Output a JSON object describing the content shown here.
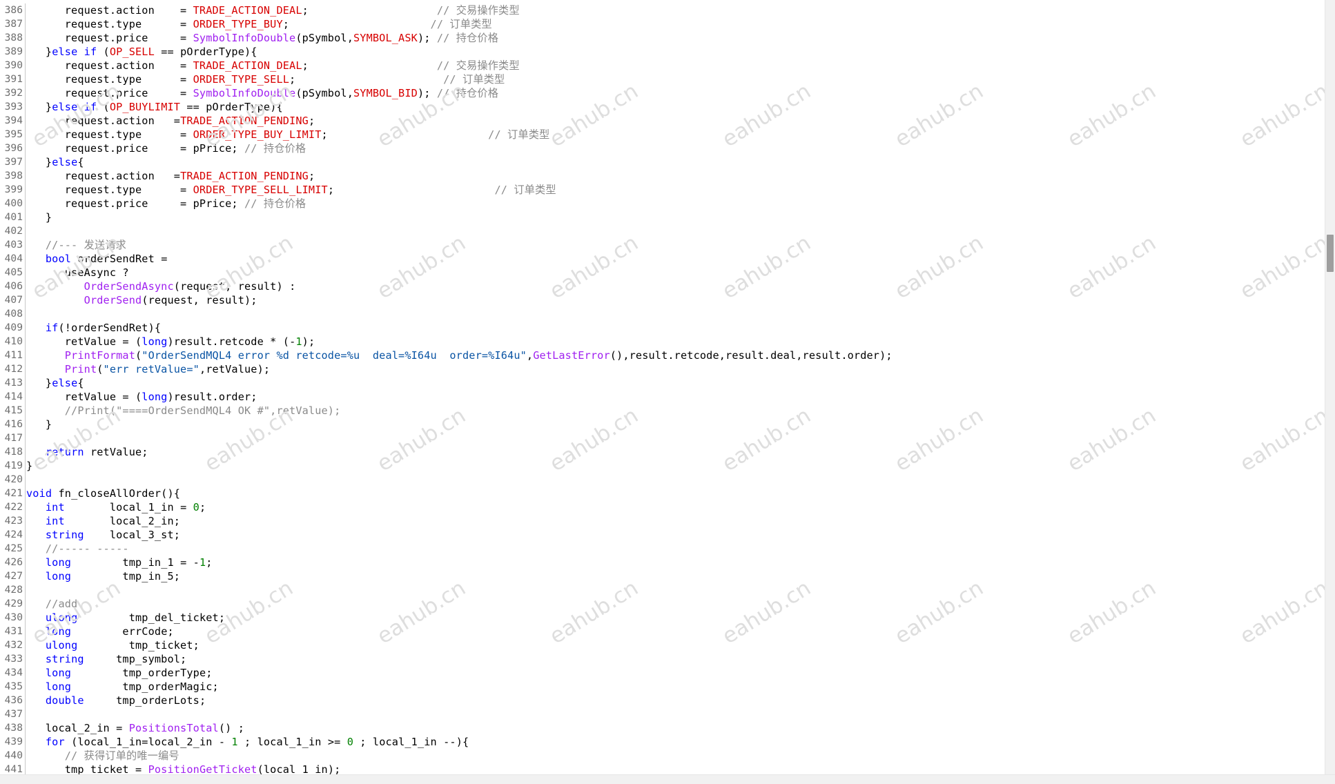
{
  "watermark": "eahub.cn",
  "lines": [
    {
      "n": "386",
      "tokens": [
        [
          "",
          "      request.action    = "
        ],
        [
          "cst",
          "TRADE_ACTION_DEAL"
        ],
        [
          "",
          ";                    "
        ],
        [
          "cm",
          "// 交易操作类型"
        ]
      ]
    },
    {
      "n": "387",
      "tokens": [
        [
          "",
          "      request.type      = "
        ],
        [
          "cst",
          "ORDER_TYPE_BUY"
        ],
        [
          "",
          ";                      "
        ],
        [
          "cm",
          "// 订单类型"
        ]
      ]
    },
    {
      "n": "388",
      "tokens": [
        [
          "",
          "      request.price     = "
        ],
        [
          "fn",
          "SymbolInfoDouble"
        ],
        [
          "",
          "(pSymbol,"
        ],
        [
          "cst",
          "SYMBOL_ASK"
        ],
        [
          "",
          "); "
        ],
        [
          "cm",
          "// 持仓价格"
        ]
      ]
    },
    {
      "n": "389",
      "tokens": [
        [
          "",
          "   }"
        ],
        [
          "kw",
          "else if"
        ],
        [
          "",
          " ("
        ],
        [
          "cst",
          "OP_SELL"
        ],
        [
          "",
          " == pOrderType){"
        ]
      ]
    },
    {
      "n": "390",
      "tokens": [
        [
          "",
          "      request.action    = "
        ],
        [
          "cst",
          "TRADE_ACTION_DEAL"
        ],
        [
          "",
          ";                    "
        ],
        [
          "cm",
          "// 交易操作类型"
        ]
      ]
    },
    {
      "n": "391",
      "tokens": [
        [
          "",
          "      request.type      = "
        ],
        [
          "cst",
          "ORDER_TYPE_SELL"
        ],
        [
          "",
          ";                       "
        ],
        [
          "cm",
          "// 订单类型"
        ]
      ]
    },
    {
      "n": "392",
      "tokens": [
        [
          "",
          "      request.price     = "
        ],
        [
          "fn",
          "SymbolInfoDouble"
        ],
        [
          "",
          "(pSymbol,"
        ],
        [
          "cst",
          "SYMBOL_BID"
        ],
        [
          "",
          "); "
        ],
        [
          "cm",
          "// 持仓价格"
        ]
      ]
    },
    {
      "n": "393",
      "tokens": [
        [
          "",
          "   }"
        ],
        [
          "kw",
          "else if"
        ],
        [
          "",
          " ("
        ],
        [
          "cst",
          "OP_BUYLIMIT"
        ],
        [
          "",
          " == pOrderType){"
        ]
      ]
    },
    {
      "n": "394",
      "tokens": [
        [
          "",
          "      request.action   ="
        ],
        [
          "cst",
          "TRADE_ACTION_PENDING"
        ],
        [
          ";",
          ";"
        ]
      ]
    },
    {
      "n": "395",
      "tokens": [
        [
          "",
          "      request.type      = "
        ],
        [
          "cst",
          "ORDER_TYPE_BUY_LIMIT"
        ],
        [
          "",
          ";                         "
        ],
        [
          "cm",
          "// 订单类型"
        ]
      ]
    },
    {
      "n": "396",
      "tokens": [
        [
          "",
          "      request.price     = pPrice; "
        ],
        [
          "cm",
          "// 持仓价格"
        ]
      ]
    },
    {
      "n": "397",
      "tokens": [
        [
          "",
          "   }"
        ],
        [
          "kw",
          "else"
        ],
        [
          "",
          "{"
        ]
      ]
    },
    {
      "n": "398",
      "tokens": [
        [
          "",
          "      request.action   ="
        ],
        [
          "cst",
          "TRADE_ACTION_PENDING"
        ],
        [
          "",
          ";"
        ]
      ]
    },
    {
      "n": "399",
      "tokens": [
        [
          "",
          "      request.type      = "
        ],
        [
          "cst",
          "ORDER_TYPE_SELL_LIMIT"
        ],
        [
          "",
          ";                         "
        ],
        [
          "cm",
          "// 订单类型"
        ]
      ]
    },
    {
      "n": "400",
      "tokens": [
        [
          "",
          "      request.price     = pPrice; "
        ],
        [
          "cm",
          "// 持仓价格"
        ]
      ]
    },
    {
      "n": "401",
      "tokens": [
        [
          "",
          "   }"
        ]
      ]
    },
    {
      "n": "402",
      "tokens": []
    },
    {
      "n": "403",
      "tokens": [
        [
          "cm",
          "   //--- 发送请求"
        ]
      ]
    },
    {
      "n": "404",
      "tokens": [
        [
          "",
          "   "
        ],
        [
          "ty",
          "bool"
        ],
        [
          "",
          " orderSendRet ="
        ]
      ]
    },
    {
      "n": "405",
      "tokens": [
        [
          "",
          "      useAsync ?"
        ]
      ]
    },
    {
      "n": "406",
      "tokens": [
        [
          "",
          "         "
        ],
        [
          "fn",
          "OrderSendAsync"
        ],
        [
          "",
          "(request, result) :"
        ]
      ]
    },
    {
      "n": "407",
      "tokens": [
        [
          "",
          "         "
        ],
        [
          "fn",
          "OrderSend"
        ],
        [
          "",
          "(request, result);"
        ]
      ]
    },
    {
      "n": "408",
      "tokens": []
    },
    {
      "n": "409",
      "tokens": [
        [
          "",
          "   "
        ],
        [
          "kw",
          "if"
        ],
        [
          "",
          "(!orderSendRet){"
        ]
      ]
    },
    {
      "n": "410",
      "tokens": [
        [
          "",
          "      retValue = ("
        ],
        [
          "ty",
          "long"
        ],
        [
          "",
          ")result.retcode * (-"
        ],
        [
          "num",
          "1"
        ],
        [
          "",
          ");"
        ]
      ]
    },
    {
      "n": "411",
      "tokens": [
        [
          "",
          "      "
        ],
        [
          "fn",
          "PrintFormat"
        ],
        [
          "",
          "("
        ],
        [
          "str",
          "\"OrderSendMQL4 error %d retcode=%u  deal=%I64u  order=%I64u\""
        ],
        [
          "",
          ","
        ],
        [
          "fn",
          "GetLastError"
        ],
        [
          "",
          "(),result.retcode,result.deal,result.order);"
        ]
      ]
    },
    {
      "n": "412",
      "tokens": [
        [
          "",
          "      "
        ],
        [
          "fn",
          "Print"
        ],
        [
          "",
          "("
        ],
        [
          "str",
          "\"err retValue=\""
        ],
        [
          "",
          ",retValue);"
        ]
      ]
    },
    {
      "n": "413",
      "tokens": [
        [
          "",
          "   }"
        ],
        [
          "kw",
          "else"
        ],
        [
          "",
          "{"
        ]
      ]
    },
    {
      "n": "414",
      "tokens": [
        [
          "",
          "      retValue = ("
        ],
        [
          "ty",
          "long"
        ],
        [
          "",
          ")result.order;"
        ]
      ]
    },
    {
      "n": "415",
      "tokens": [
        [
          "cm",
          "      //Print(\"====OrderSendMQL4 OK #\",retValue);"
        ]
      ]
    },
    {
      "n": "416",
      "tokens": [
        [
          "",
          "   }"
        ]
      ]
    },
    {
      "n": "417",
      "tokens": []
    },
    {
      "n": "418",
      "tokens": [
        [
          "",
          "   "
        ],
        [
          "kw",
          "return"
        ],
        [
          "",
          " retValue;"
        ]
      ]
    },
    {
      "n": "419",
      "tokens": [
        [
          "",
          "}"
        ]
      ]
    },
    {
      "n": "420",
      "tokens": []
    },
    {
      "n": "421",
      "tokens": [
        [
          "ty",
          "void"
        ],
        [
          "",
          " fn_closeAllOrder(){"
        ]
      ]
    },
    {
      "n": "422",
      "tokens": [
        [
          "",
          "   "
        ],
        [
          "ty",
          "int"
        ],
        [
          "",
          "       local_1_in = "
        ],
        [
          "num",
          "0"
        ],
        [
          "",
          ";"
        ]
      ]
    },
    {
      "n": "423",
      "tokens": [
        [
          "",
          "   "
        ],
        [
          "ty",
          "int"
        ],
        [
          "",
          "       local_2_in;"
        ]
      ]
    },
    {
      "n": "424",
      "tokens": [
        [
          "",
          "   "
        ],
        [
          "ty",
          "string"
        ],
        [
          "",
          "    local_3_st;"
        ]
      ]
    },
    {
      "n": "425",
      "tokens": [
        [
          "cm",
          "   //----- -----"
        ]
      ]
    },
    {
      "n": "426",
      "tokens": [
        [
          "",
          "   "
        ],
        [
          "ty",
          "long"
        ],
        [
          "",
          "        tmp_in_1 = -"
        ],
        [
          "num",
          "1"
        ],
        [
          "",
          ";"
        ]
      ]
    },
    {
      "n": "427",
      "tokens": [
        [
          "",
          "   "
        ],
        [
          "ty",
          "long"
        ],
        [
          "",
          "        tmp_in_5;"
        ]
      ]
    },
    {
      "n": "428",
      "tokens": []
    },
    {
      "n": "429",
      "tokens": [
        [
          "cm",
          "   //add"
        ]
      ]
    },
    {
      "n": "430",
      "tokens": [
        [
          "",
          "   "
        ],
        [
          "ty",
          "ulong"
        ],
        [
          "",
          "        tmp_del_ticket;"
        ]
      ]
    },
    {
      "n": "431",
      "tokens": [
        [
          "",
          "   "
        ],
        [
          "ty",
          "long"
        ],
        [
          "",
          "        errCode;"
        ]
      ]
    },
    {
      "n": "432",
      "tokens": [
        [
          "",
          "   "
        ],
        [
          "ty",
          "ulong"
        ],
        [
          "",
          "        tmp_ticket;"
        ]
      ]
    },
    {
      "n": "433",
      "tokens": [
        [
          "",
          "   "
        ],
        [
          "ty",
          "string"
        ],
        [
          "",
          "     tmp_symbol;"
        ]
      ]
    },
    {
      "n": "434",
      "tokens": [
        [
          "",
          "   "
        ],
        [
          "ty",
          "long"
        ],
        [
          "",
          "        tmp_orderType;"
        ]
      ]
    },
    {
      "n": "435",
      "tokens": [
        [
          "",
          "   "
        ],
        [
          "ty",
          "long"
        ],
        [
          "",
          "        tmp_orderMagic;"
        ]
      ]
    },
    {
      "n": "436",
      "tokens": [
        [
          "",
          "   "
        ],
        [
          "ty",
          "double"
        ],
        [
          "",
          "     tmp_orderLots;"
        ]
      ]
    },
    {
      "n": "437",
      "tokens": []
    },
    {
      "n": "438",
      "tokens": [
        [
          "",
          "   local_2_in = "
        ],
        [
          "fn",
          "PositionsTotal"
        ],
        [
          "",
          "() ;"
        ]
      ]
    },
    {
      "n": "439",
      "tokens": [
        [
          "",
          "   "
        ],
        [
          "kw",
          "for"
        ],
        [
          "",
          " (local_1_in=local_2_in - "
        ],
        [
          "num",
          "1"
        ],
        [
          "",
          " ; local_1_in >= "
        ],
        [
          "num",
          "0"
        ],
        [
          "",
          " ; local_1_in --){"
        ]
      ]
    },
    {
      "n": "440",
      "tokens": [
        [
          "cm",
          "      // 获得订单的唯一编号"
        ]
      ]
    },
    {
      "n": "441",
      "tokens": [
        [
          "",
          "      tmp_ticket = "
        ],
        [
          "fn",
          "PositionGetTicket"
        ],
        [
          "",
          "(local_1_in);"
        ]
      ]
    }
  ]
}
